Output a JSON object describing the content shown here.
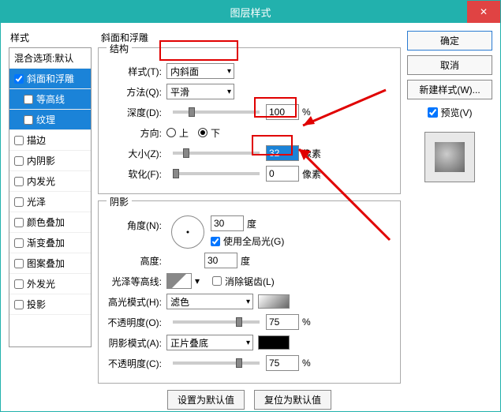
{
  "window": {
    "title": "图层样式"
  },
  "leftPanel": {
    "label": "样式",
    "items": [
      {
        "id": "blend",
        "label": "混合选项:默认",
        "indent": false,
        "checked": false,
        "selected": false,
        "showCb": false
      },
      {
        "id": "bevel",
        "label": "斜面和浮雕",
        "indent": false,
        "checked": true,
        "selected": true,
        "showCb": true
      },
      {
        "id": "contour",
        "label": "等高线",
        "indent": true,
        "checked": false,
        "selected": true,
        "showCb": true
      },
      {
        "id": "texture",
        "label": "纹理",
        "indent": true,
        "checked": false,
        "selected": true,
        "showCb": true
      },
      {
        "id": "stroke",
        "label": "描边",
        "indent": false,
        "checked": false,
        "selected": false,
        "showCb": true
      },
      {
        "id": "innerShadow",
        "label": "内阴影",
        "indent": false,
        "checked": false,
        "selected": false,
        "showCb": true
      },
      {
        "id": "innerGlow",
        "label": "内发光",
        "indent": false,
        "checked": false,
        "selected": false,
        "showCb": true
      },
      {
        "id": "satin",
        "label": "光泽",
        "indent": false,
        "checked": false,
        "selected": false,
        "showCb": true
      },
      {
        "id": "colorOverlay",
        "label": "颜色叠加",
        "indent": false,
        "checked": false,
        "selected": false,
        "showCb": true
      },
      {
        "id": "gradOverlay",
        "label": "渐变叠加",
        "indent": false,
        "checked": false,
        "selected": false,
        "showCb": true
      },
      {
        "id": "patOverlay",
        "label": "图案叠加",
        "indent": false,
        "checked": false,
        "selected": false,
        "showCb": true
      },
      {
        "id": "outerGlow",
        "label": "外发光",
        "indent": false,
        "checked": false,
        "selected": false,
        "showCb": true
      },
      {
        "id": "dropShadow",
        "label": "投影",
        "indent": false,
        "checked": false,
        "selected": false,
        "showCb": true
      }
    ]
  },
  "center": {
    "groupTitle": "斜面和浮雕",
    "structure": {
      "legend": "结构",
      "styleLabel": "样式(T):",
      "styleValue": "内斜面",
      "techLabel": "方法(Q):",
      "techValue": "平滑",
      "depthLabel": "深度(D):",
      "depthValue": "100",
      "depthUnit": "%",
      "dirLabel": "方向:",
      "dirUp": "上",
      "dirDown": "下",
      "sizeLabel": "大小(Z):",
      "sizeValue": "32",
      "sizeUnit": "像素",
      "softLabel": "软化(F):",
      "softValue": "0",
      "softUnit": "像素"
    },
    "shading": {
      "legend": "阴影",
      "angleLabel": "角度(N):",
      "angleValue": "30",
      "angleUnit": "度",
      "globalLabel": "使用全局光(G)",
      "altLabel": "高度:",
      "altValue": "30",
      "altUnit": "度",
      "glossLabel": "光泽等高线:",
      "antiLabel": "消除锯齿(L)",
      "hiModeLabel": "高光模式(H):",
      "hiModeValue": "滤色",
      "hiOpLabel": "不透明度(O):",
      "hiOpValue": "75",
      "hiOpUnit": "%",
      "shModeLabel": "阴影模式(A):",
      "shModeValue": "正片叠底",
      "shOpLabel": "不透明度(C):",
      "shOpValue": "75",
      "shOpUnit": "%"
    },
    "btnDefault": "设置为默认值",
    "btnReset": "复位为默认值"
  },
  "right": {
    "ok": "确定",
    "cancel": "取消",
    "newStyle": "新建样式(W)...",
    "preview": "预览(V)"
  }
}
